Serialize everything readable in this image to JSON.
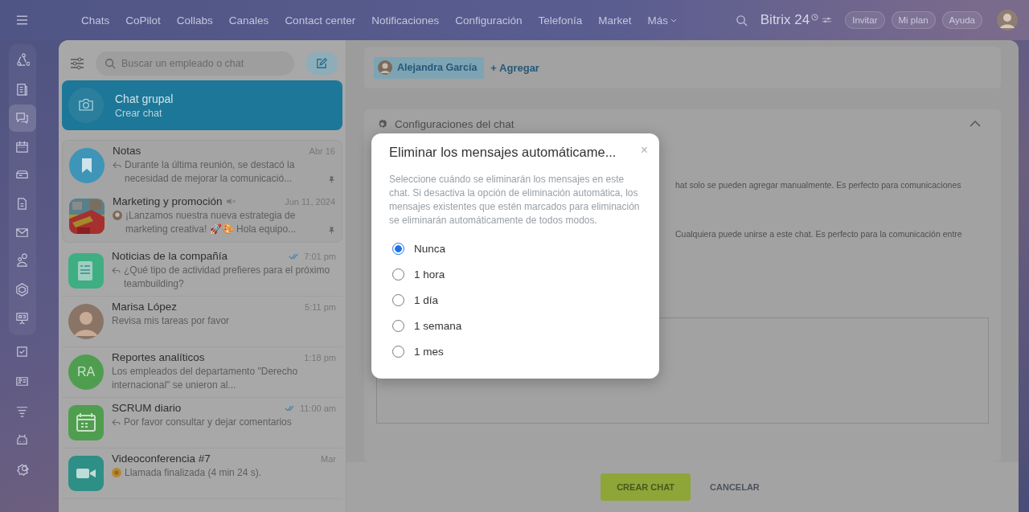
{
  "topbar": {
    "nav": [
      "Chats",
      "CoPilot",
      "Collabs",
      "Canales",
      "Contact center",
      "Notificaciones",
      "Configuración",
      "Telefonía",
      "Market",
      "Más"
    ],
    "logo": "Bitrix 24",
    "buttons": [
      "Invitar",
      "Mi plan",
      "Ayuda"
    ]
  },
  "rail": {
    "group": [
      {
        "selected": false
      },
      {
        "selected": false
      },
      {
        "selected": true
      },
      {
        "selected": false
      },
      {
        "selected": false
      },
      {
        "selected": false
      },
      {
        "selected": false
      },
      {
        "selected": false
      },
      {
        "selected": false
      },
      {
        "selected": false
      }
    ],
    "more": [
      {
        "selected": false
      },
      {
        "selected": false
      },
      {
        "selected": false
      },
      {
        "selected": false
      },
      {
        "selected": false
      }
    ]
  },
  "search": {
    "placeholder": "Buscar un empleado o chat"
  },
  "new_chat": {
    "title": "Chat grupal",
    "subtitle": "Crear chat",
    "selected": true
  },
  "pinned": [
    {
      "title": "Notas",
      "time": "Abr 16",
      "preview": "Durante la última reunión, se destacó la necesidad de mejorar la comunicació...",
      "preview_icon": {
        "kind": "reply"
      },
      "read": false,
      "muted": false,
      "pinned": true,
      "selected": false,
      "avatar": {
        "kind": "bookmark",
        "color": "#3e95b8"
      }
    },
    {
      "title": "Marketing y promoción",
      "time": "Jun 11, 2024",
      "preview": "¡Lanzamos nuestra nueva estrategia de marketing creativa! 🚀🎨 Hola equipo...",
      "preview_icon": {
        "kind": "avatar"
      },
      "read": false,
      "muted": true,
      "pinned": true,
      "selected": false
    }
  ],
  "chats": [
    {
      "title": "Noticias de la compañía",
      "time": "7:01 pm",
      "preview": "¿Qué tipo de actividad prefieres para el próximo teambuilding?",
      "preview_icon": {
        "kind": "reply"
      },
      "read": true,
      "muted": false,
      "pinned": false,
      "selected": false,
      "avatar": {
        "kind": "news",
        "color": "#3fae83"
      }
    },
    {
      "title": "Marisa López",
      "time": "5:11 pm",
      "preview": "Revisa mis tareas por favor",
      "read": false,
      "muted": false,
      "pinned": false,
      "selected": false,
      "avatar": {
        "kind": "person"
      }
    },
    {
      "title": "Reportes analíticos",
      "time": "1:18 pm",
      "preview": "Los empleados del departamento \"Derecho internacional\" se unieron al...",
      "read": false,
      "muted": false,
      "pinned": false,
      "selected": false,
      "avatar": {
        "kind": "initials",
        "text": "RA",
        "color": "#4f9e4f"
      }
    },
    {
      "title": "SCRUM diario",
      "time": "11:00 am",
      "preview": "Por favor consultar y dejar comentarios",
      "preview_icon": {
        "kind": "reply"
      },
      "read": true,
      "muted": false,
      "pinned": false,
      "selected": false,
      "avatar": {
        "kind": "calendar",
        "color": "#4f9e4f"
      }
    },
    {
      "title": "Videoconferencia #7",
      "time": "Mar",
      "preview": "Llamada finalizada (4 min 24 s).",
      "preview_icon": {
        "kind": "call"
      },
      "read": false,
      "muted": false,
      "pinned": false,
      "selected": false,
      "avatar": {
        "kind": "video",
        "color": "#2e8f86"
      }
    }
  ],
  "members": {
    "chip": "Alejandra García",
    "add": "+ Agregar"
  },
  "settings": {
    "title": "Configuraciones del chat",
    "expanded": true,
    "lines": [
      "hat solo se pueden agregar manualmente. Es perfecto para comunicaciones",
      "Cualquiera puede unirse a este chat. Es perfecto para la comunicación entre"
    ]
  },
  "footer": {
    "primary": "CREAR CHAT",
    "secondary": "CANCELAR"
  },
  "dialog": {
    "title": "Eliminar los mensajes automáticame...",
    "close": "×",
    "description": "Seleccione cuándo se eliminarán los mensajes en este chat. Si desactiva la opción de eliminación automática, los mensajes existentes que estén marcados para eliminación se eliminarán automáticamente de todos modos.",
    "options": [
      {
        "label": "Nunca",
        "selected": true
      },
      {
        "label": "1 hora",
        "selected": false
      },
      {
        "label": "1 día",
        "selected": false
      },
      {
        "label": "1 semana",
        "selected": false
      },
      {
        "label": "1 mes",
        "selected": false
      }
    ]
  }
}
